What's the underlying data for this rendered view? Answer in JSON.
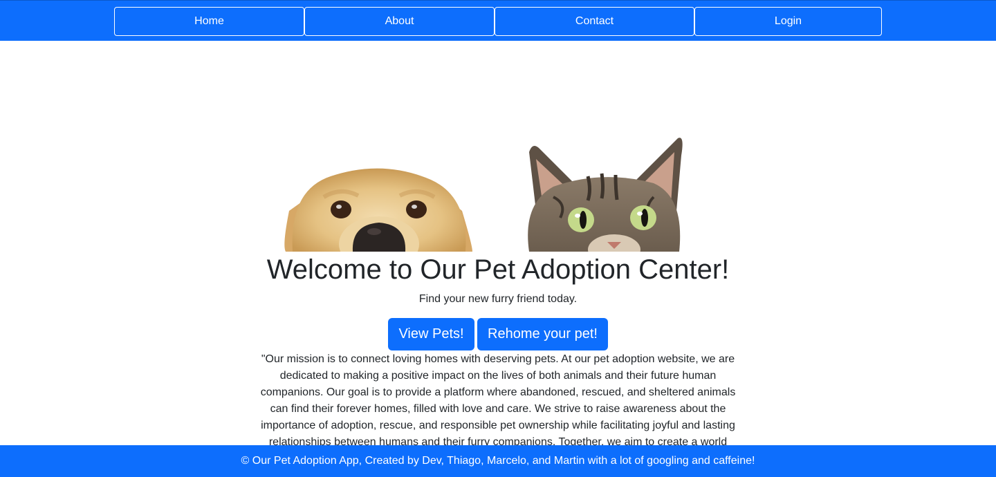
{
  "nav": {
    "items": [
      {
        "label": "Home"
      },
      {
        "label": "About"
      },
      {
        "label": "Contact"
      },
      {
        "label": "Login"
      }
    ]
  },
  "hero": {
    "title": "Welcome to Our Pet Adoption Center!",
    "subtitle": "Find your new furry friend today.",
    "buttons": {
      "view_pets": "View Pets!",
      "rehome": "Rehome your pet!"
    }
  },
  "mission": {
    "text": "\"Our mission is to connect loving homes with deserving pets. At our pet adoption website, we are dedicated to making a positive impact on the lives of both animals and their future human companions. Our goal is to provide a platform where abandoned, rescued, and sheltered animals can find their forever homes, filled with love and care. We strive to raise awareness about the importance of adoption, rescue, and responsible pet ownership while facilitating joyful and lasting relationships between humans and their furry companions. Together, we aim to create a world"
  },
  "footer": {
    "text": "© Our Pet Adoption App, Created by Dev, Thiago, Marcelo, and Martin with a lot of googling and caffeine!"
  },
  "colors": {
    "primary": "#0d6efd",
    "text": "#212529",
    "background": "#ffffff"
  }
}
